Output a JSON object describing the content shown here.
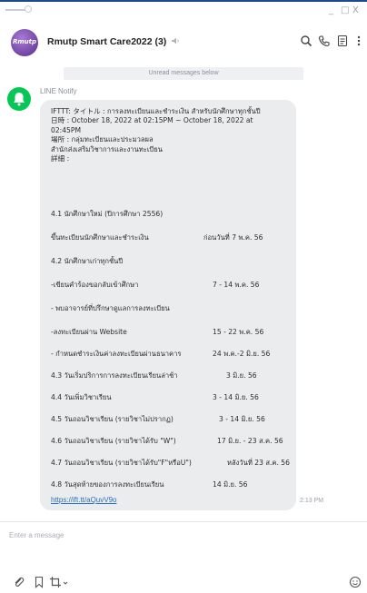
{
  "window": {
    "minimize": "_",
    "maximize": "□",
    "close": "X"
  },
  "header": {
    "avatar_text": "Rmutp",
    "title": "Rmutp Smart Care2022 (3)"
  },
  "unread_label": "Unread messages below",
  "message": {
    "sender": "LINE Notify",
    "intro": [
      "IFTTT: タイトル : การลงทะเบียนและชำระเงิน สำหรับนักศึกษาทุกชั้นปี",
      "日時 : October 18, 2022 at 02:15PM ~ October 18, 2022 at",
      "02:45PM",
      "場所 : กลุ่มทะเบียนและประมวลผล",
      "สำนักส่งเสริมวิชาการและงานทะเบียน",
      "詳細 :"
    ],
    "rows": [
      {
        "label": "4.1 นักศึกษาใหม่ (ปีการศึกษา 2556)",
        "value": ""
      },
      {
        "label": "ขึ้นทะเบียนนักศึกษาและชำระเงิน",
        "value": "ก่อนวันที่ 7 พ.ค. 56"
      },
      {
        "label": "4.2 นักศึกษาเก่าทุกชั้นปี",
        "value": ""
      },
      {
        "label": "-เขียนคำร้องขอกลับเข้าศึกษา",
        "value": "7 - 14 พ.ค. 56"
      },
      {
        "label": "- พบอาจารย์ที่ปรึกษาดูแลการลงทะเบียน",
        "value": ""
      },
      {
        "label": "-ลงทะเบียนผ่าน Website",
        "value": "15 - 22 พ.ค. 56"
      },
      {
        "label": "- กำหนดชำระเงินค่าลงทะเบียนผ่านธนาคาร",
        "value": "24 พ.ค.-2 มิ.ย. 56"
      },
      {
        "label": "4.3 วันเริ่มปริการการลงทะเบียนเรียนล่าช้า",
        "value": "3 มิ.ย. 56"
      },
      {
        "label": "4.4 วันเพิ่มวิชาเรียน",
        "value": "3 - 14 มิ.ย. 56"
      },
      {
        "label": "4.5 วันถอนวิชาเรียน (รายวิชาไม่ปรากฏ)",
        "value": "3 - 14 มิ.ย. 56"
      },
      {
        "label": "4.6 วันถอนวิชาเรียน (รายวิชาได้รับ \"W\")",
        "value": "17 มิ.ย. - 23 ส.ค. 56"
      },
      {
        "label": "4.7 วันถอนวิชาเรียน (รายวิชาได้รับ\"F\"หรือU\")",
        "value": "หลังวันที่ 23 ส.ค. 56"
      },
      {
        "label": "4.8 วันสุดท้ายของการลงทะเบียนเรียน",
        "value": "14 มิ.ย. 56"
      }
    ],
    "link": "https://ift.tt/aQuvV9o",
    "time": "2:13 PM"
  },
  "composer": {
    "placeholder": "Enter a message"
  }
}
